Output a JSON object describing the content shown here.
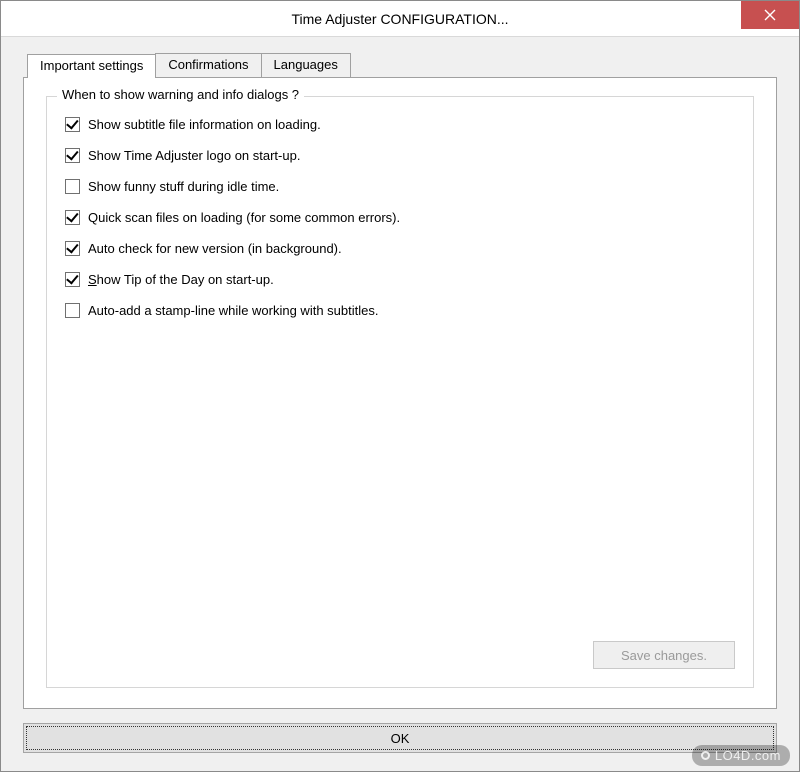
{
  "window": {
    "title": "Time Adjuster CONFIGURATION..."
  },
  "tabs": [
    {
      "label": "Important settings",
      "active": true
    },
    {
      "label": "Confirmations",
      "active": false
    },
    {
      "label": "Languages",
      "active": false
    }
  ],
  "groupbox": {
    "title": "When to show warning and info dialogs ?"
  },
  "options": [
    {
      "label": "Show subtitle file information on loading.",
      "checked": true
    },
    {
      "label": "Show Time Adjuster logo on start-up.",
      "checked": true
    },
    {
      "label": "Show funny stuff during idle time.",
      "checked": false
    },
    {
      "label": "Quick scan files on loading (for some common errors).",
      "checked": true
    },
    {
      "label": "Auto check for new version (in background).",
      "checked": true
    },
    {
      "label": "Show Tip of the Day on start-up.",
      "checked": true,
      "underline_first": true
    },
    {
      "label": "Auto-add a stamp-line while working with subtitles.",
      "checked": false
    }
  ],
  "buttons": {
    "save": "Save changes.",
    "ok": "OK"
  },
  "watermark": "LO4D.com"
}
